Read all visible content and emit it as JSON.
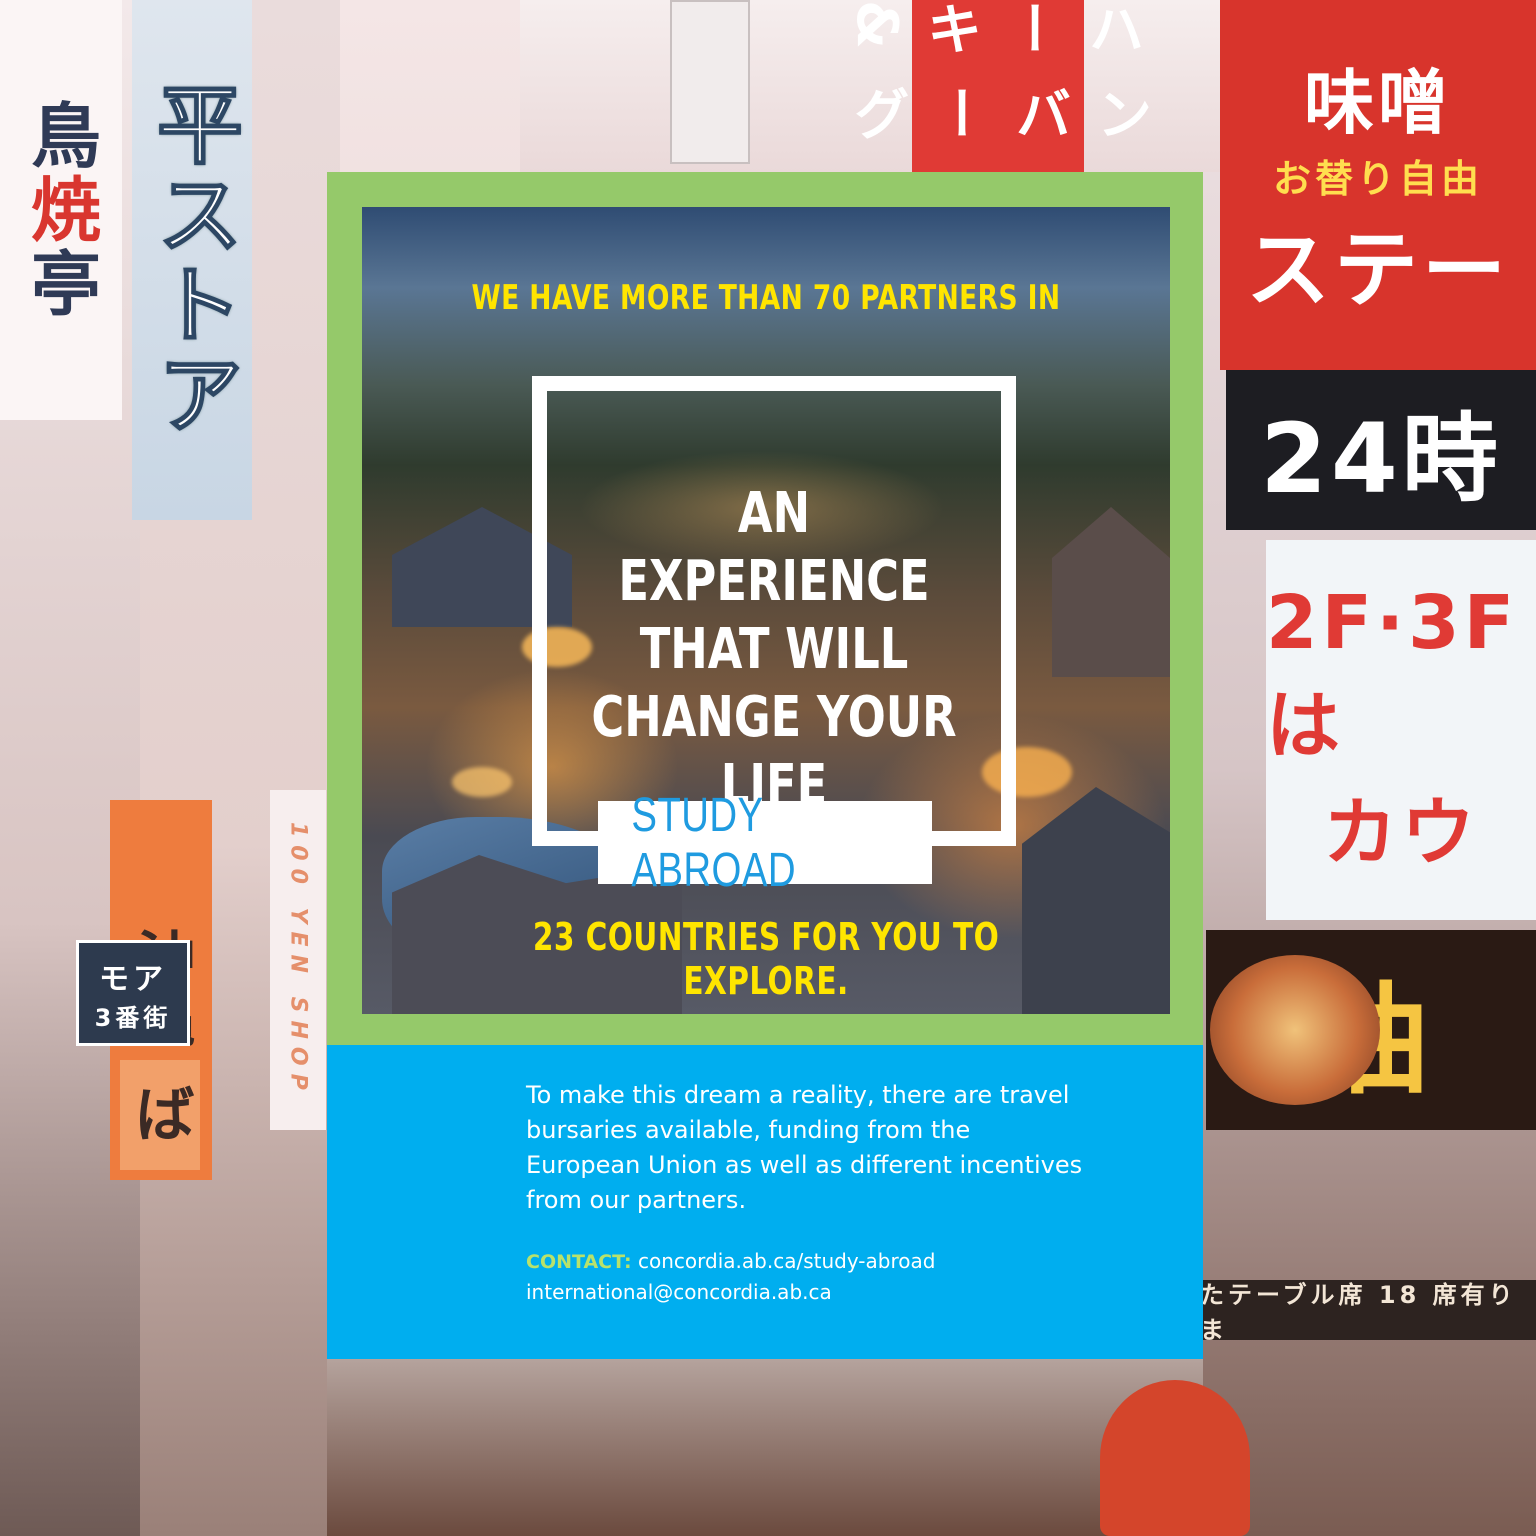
{
  "background": {
    "signs": [
      "平ストア",
      "焼",
      "鳥",
      "亭",
      "沖縄",
      "モア",
      "3番街",
      "ば",
      "100 YEN SHOP",
      "味噌",
      "お替り自由",
      "ステー",
      "24時",
      "2F·3Fは",
      "カウ",
      "油",
      "たテーブル席 18 席有りま",
      "ハーキ&",
      "ンバーグ"
    ]
  },
  "poster": {
    "top_line": "WE HAVE MORE THAN 70 PARTNERS IN",
    "title": "AN EXPERIENCE\nTHAT WILL\nCHANGE YOUR\nLIFE",
    "badge": "STUDY ABROAD",
    "bottom_line": "23 COUNTRIES FOR YOU TO EXPLORE."
  },
  "info": {
    "body": "To make this dream a reality, there are travel bursaries available, funding from the European Union as well as different incentives from our partners.",
    "contact_label": "CONTACT:",
    "contact_url": "concordia.ab.ca/study-abroad",
    "contact_email": "international@concordia.ab.ca"
  },
  "colors": {
    "frame_green": "#95c96a",
    "headline_yellow": "#ffe500",
    "info_blue": "#00aeef",
    "badge_text_blue": "#1f9be0",
    "contact_label_green": "#b8e26b"
  }
}
